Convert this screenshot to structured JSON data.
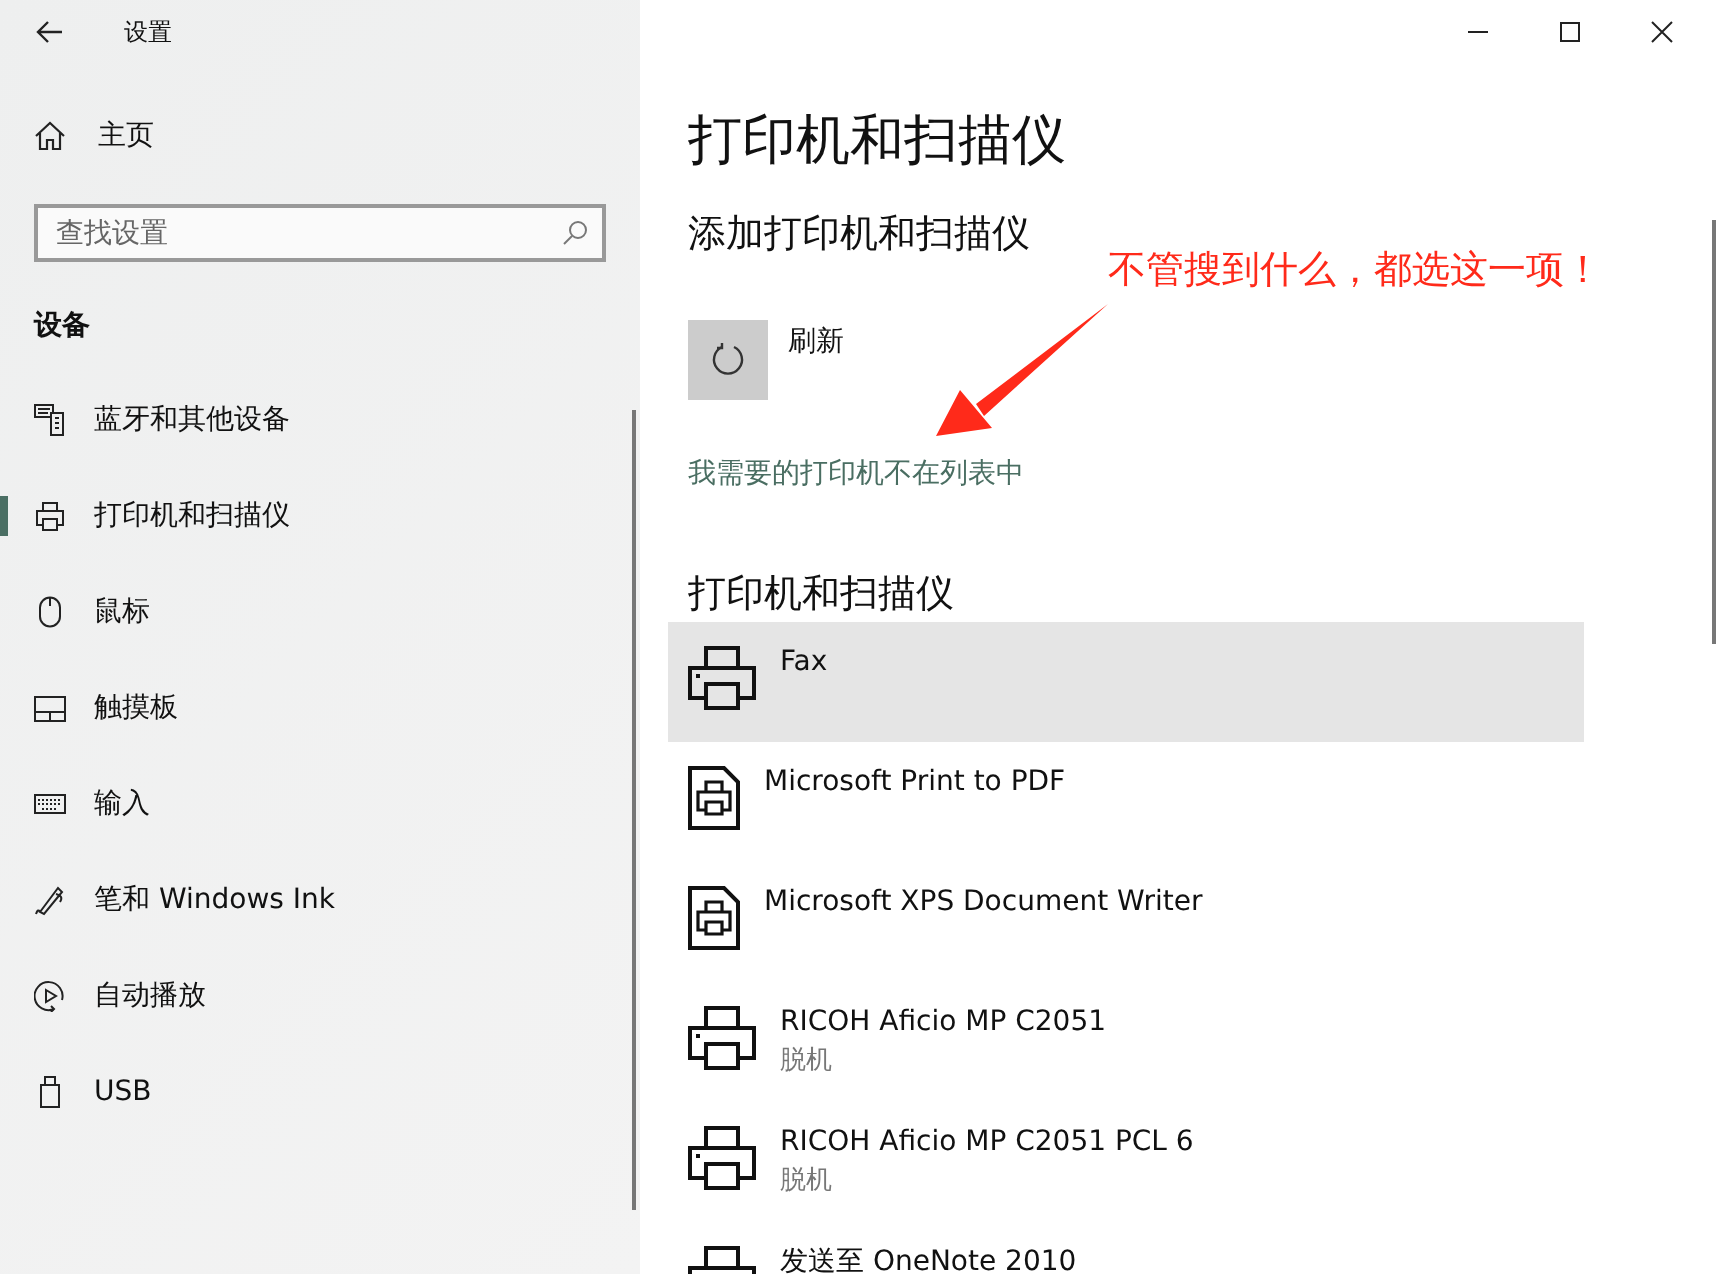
{
  "window": {
    "title": "设置"
  },
  "sidebar": {
    "home": "主页",
    "search": {
      "placeholder": "查找设置"
    },
    "section": "设备",
    "items": [
      {
        "label": "蓝牙和其他设备",
        "selected": false
      },
      {
        "label": "打印机和扫描仪",
        "selected": true
      },
      {
        "label": "鼠标",
        "selected": false
      },
      {
        "label": "触摸板",
        "selected": false
      },
      {
        "label": "输入",
        "selected": false
      },
      {
        "label": "笔和 Windows Ink",
        "selected": false
      },
      {
        "label": "自动播放",
        "selected": false
      },
      {
        "label": "USB",
        "selected": false
      }
    ]
  },
  "main": {
    "title": "打印机和扫描仪",
    "add_heading": "添加打印机和扫描仪",
    "refresh": "刷新",
    "link": "我需要的打印机不在列表中",
    "list_heading": "打印机和扫描仪",
    "printers": [
      {
        "kind": "printer",
        "name": "Fax",
        "selected": true
      },
      {
        "kind": "document",
        "name": "Microsoft Print to PDF",
        "selected": false
      },
      {
        "kind": "document",
        "name": "Microsoft XPS Document Writer",
        "selected": false
      },
      {
        "kind": "printer",
        "name": "RICOH Aficio MP C2051",
        "status": "脱机",
        "selected": false
      },
      {
        "kind": "printer",
        "name": "RICOH Aficio MP C2051 PCL 6",
        "status": "脱机",
        "selected": false
      },
      {
        "kind": "printer",
        "name": "发送至 OneNote 2010",
        "selected": false
      }
    ]
  },
  "annotation": {
    "text": "不管搜到什么，都选这一项！"
  }
}
